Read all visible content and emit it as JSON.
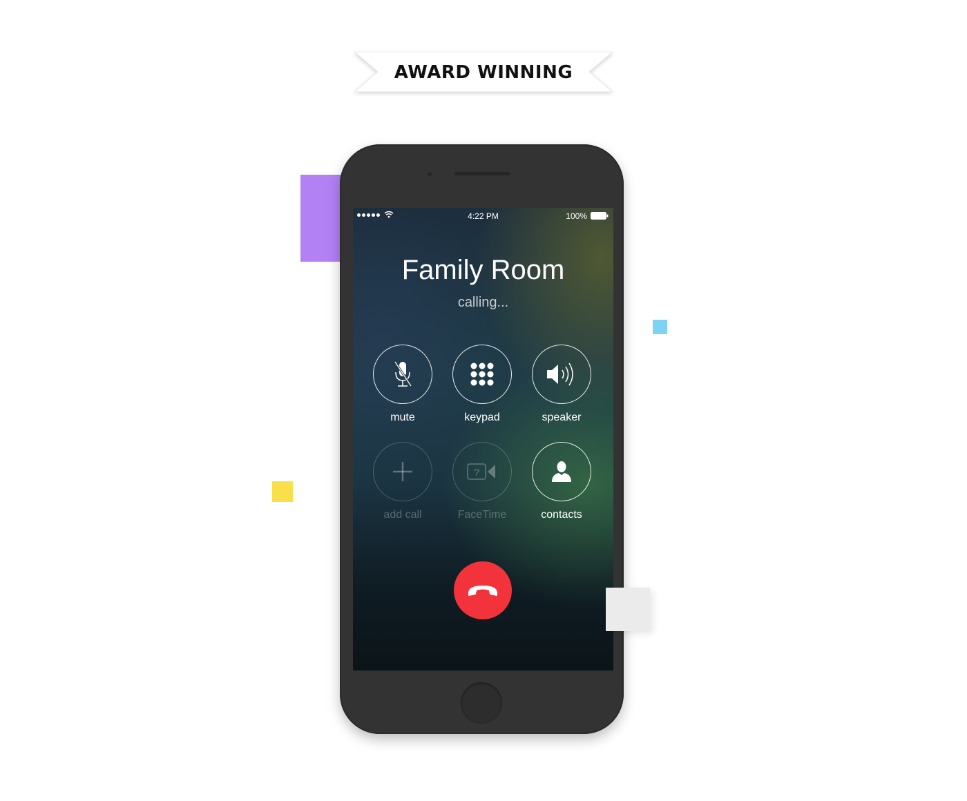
{
  "banner": {
    "text": "AWARD WINNING"
  },
  "status_bar": {
    "time": "4:22 PM",
    "battery_percent": "100%",
    "signal_bars": 5,
    "signal_icon": "signal-dots-icon",
    "wifi_icon": "wifi-icon",
    "battery_icon": "battery-full-icon"
  },
  "call": {
    "caller_name": "Family Room",
    "status": "calling...",
    "buttons": [
      {
        "label": "mute",
        "icon": "microphone-muted-icon",
        "enabled": true
      },
      {
        "label": "keypad",
        "icon": "keypad-icon",
        "enabled": true
      },
      {
        "label": "speaker",
        "icon": "speaker-icon",
        "enabled": true
      },
      {
        "label": "add call",
        "icon": "plus-icon",
        "enabled": false
      },
      {
        "label": "FaceTime",
        "icon": "facetime-icon",
        "enabled": false
      },
      {
        "label": "contacts",
        "icon": "contact-person-icon",
        "enabled": true
      }
    ],
    "end_call_icon": "hang-up-icon"
  },
  "colors": {
    "end_call": "#f2333b",
    "phone_body": "#333333",
    "deco_purple": "#b281f4",
    "deco_blue": "#7ed3f5",
    "deco_yellow": "#f9e04b",
    "deco_gray": "#ebebeb"
  }
}
